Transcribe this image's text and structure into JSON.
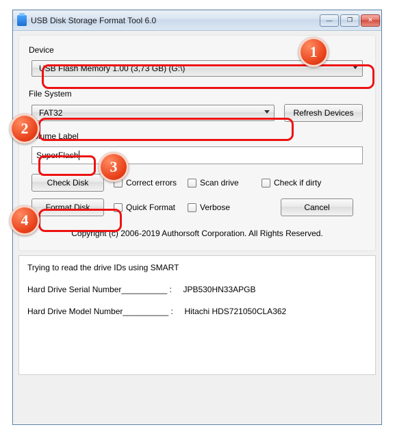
{
  "window": {
    "title": "USB Disk Storage Format Tool 6.0",
    "minimize": "—",
    "maximize": "❐",
    "close": "✕"
  },
  "labels": {
    "device": "Device",
    "filesystem": "File System",
    "volume": "Volume Label"
  },
  "device": {
    "selected": "USB Flash Memory  1.00 (3,73 GB) (G:\\)"
  },
  "filesystem": {
    "selected": "FAT32"
  },
  "volume": {
    "value": "SuperFlash"
  },
  "buttons": {
    "refresh": "Refresh Devices",
    "check": "Check Disk",
    "format": "Format Disk",
    "cancel": "Cancel"
  },
  "checks": {
    "correct": "Correct errors",
    "scan": "Scan drive",
    "dirty": "Check if dirty",
    "quick": "Quick Format",
    "verbose": "Verbose"
  },
  "copyright": "Copyright (c) 2006-2019 Authorsoft Corporation. All Rights Reserved.",
  "log": {
    "l1": "Trying to read the drive IDs using SMART",
    "l2": "Hard Drive Serial Number__________ :     JPB530HN33APGB",
    "l3": "Hard Drive Model Number__________ :     Hitachi HDS721050CLA362"
  },
  "annotations": {
    "n1": "1",
    "n2": "2",
    "n3": "3",
    "n4": "4"
  }
}
